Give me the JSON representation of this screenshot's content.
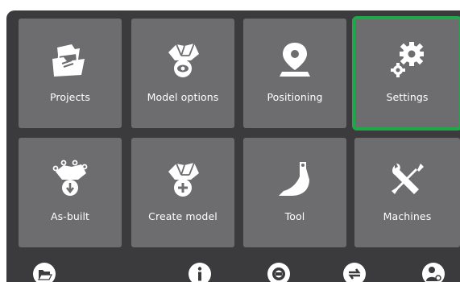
{
  "tiles": [
    {
      "id": "projects",
      "label": "Projects",
      "icon": "projects-folder-icon"
    },
    {
      "id": "model-options",
      "label": "Model options",
      "icon": "model-eye-icon"
    },
    {
      "id": "positioning",
      "label": "Positioning",
      "icon": "location-pin-icon"
    },
    {
      "id": "settings",
      "label": "Settings",
      "icon": "gears-icon",
      "selected": true
    },
    {
      "id": "as-built",
      "label": "As-built",
      "icon": "as-built-points-icon"
    },
    {
      "id": "create-model",
      "label": "Create model",
      "icon": "model-add-icon"
    },
    {
      "id": "tool",
      "label": "Tool",
      "icon": "bucket-icon"
    },
    {
      "id": "machines",
      "label": "Machines",
      "icon": "wrench-screwdriver-icon"
    }
  ],
  "bottom_bar": [
    {
      "id": "projects-shortcut",
      "icon": "folder-shortcut-icon"
    },
    {
      "id": "info",
      "icon": "info-icon"
    },
    {
      "id": "machine-settings",
      "icon": "machine-gear-icon"
    },
    {
      "id": "sync",
      "icon": "sync-arrows-icon"
    },
    {
      "id": "user-key",
      "icon": "user-key-icon"
    }
  ],
  "colors": {
    "background": "#3b3b3d",
    "tile": "#6d6d70",
    "selected": "#1ea84a",
    "icon": "#ffffff"
  }
}
